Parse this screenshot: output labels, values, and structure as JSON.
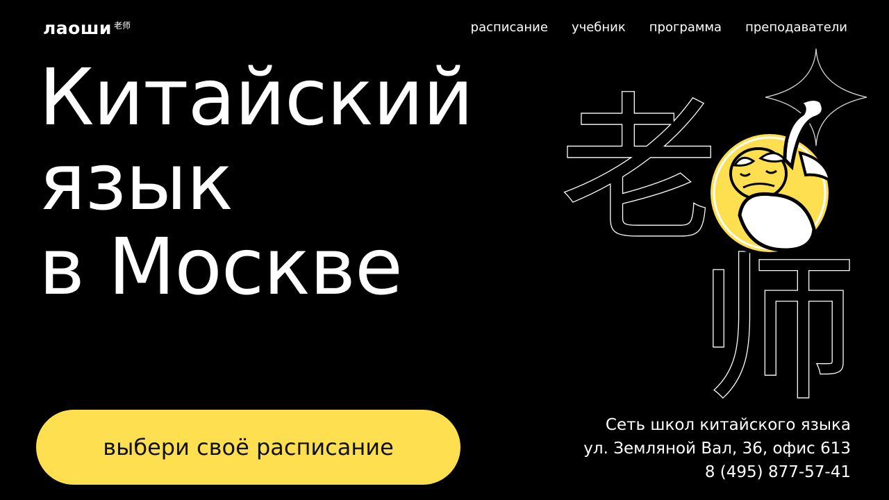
{
  "header": {
    "logo_text": "лаоши",
    "logo_hanzi": "老师",
    "nav": [
      {
        "label": "расписание"
      },
      {
        "label": "учебник"
      },
      {
        "label": "программа"
      },
      {
        "label": "преподаватели"
      }
    ]
  },
  "hero": {
    "title_lines": [
      "Китайский",
      "язык",
      "в Москве"
    ],
    "cta_label": "выбери своё расписание"
  },
  "contacts": {
    "tagline": "Сеть школ китайского языка",
    "address": "ул. Земляной Вал, 36, офис 613",
    "phone": "8 (495) 877-57-41"
  },
  "illustration": {
    "characters": "老师",
    "icon": "old-teacher-mascot-icon"
  },
  "colors": {
    "background": "#000000",
    "accent": "#fddf4f",
    "text": "#ffffff",
    "cta_text": "#111111"
  }
}
